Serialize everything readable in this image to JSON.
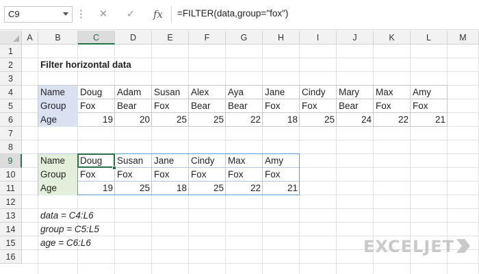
{
  "name_box": {
    "value": "C9"
  },
  "formula_bar": {
    "cancel_glyph": "✕",
    "enter_glyph": "✓",
    "fx_label": "fx",
    "formula": "=FILTER(data,group=\"fox\")"
  },
  "columns": [
    "A",
    "B",
    "C",
    "D",
    "E",
    "F",
    "G",
    "H",
    "I",
    "J",
    "K",
    "L",
    "M"
  ],
  "rows": [
    "1",
    "2",
    "3",
    "4",
    "5",
    "6",
    "7",
    "8",
    "9",
    "10",
    "11",
    "12",
    "13",
    "14",
    "15",
    "16"
  ],
  "selected": {
    "column": "C",
    "row": "9"
  },
  "title": "Filter horizontal data",
  "source_table": {
    "header_color": "#d9e1f2",
    "labels": [
      "Name",
      "Group",
      "Age"
    ],
    "names": [
      "Doug",
      "Adam",
      "Susan",
      "Alex",
      "Aya",
      "Jane",
      "Cindy",
      "Mary",
      "Max",
      "Amy"
    ],
    "groups": [
      "Fox",
      "Bear",
      "Fox",
      "Bear",
      "Bear",
      "Fox",
      "Fox",
      "Bear",
      "Fox",
      "Fox"
    ],
    "ages": [
      "19",
      "20",
      "25",
      "25",
      "22",
      "18",
      "25",
      "24",
      "22",
      "21"
    ]
  },
  "result_table": {
    "header_color": "#e2efda",
    "labels": [
      "Name",
      "Group",
      "Age"
    ],
    "names": [
      "Doug",
      "Susan",
      "Jane",
      "Cindy",
      "Max",
      "Amy"
    ],
    "groups": [
      "Fox",
      "Fox",
      "Fox",
      "Fox",
      "Fox",
      "Fox"
    ],
    "ages": [
      "19",
      "25",
      "18",
      "25",
      "22",
      "21"
    ]
  },
  "notes": [
    "data = C4:L6",
    "group = C5:L5",
    "age = C6:L6"
  ],
  "logo": {
    "text": "EXCELJET",
    "color": "#c9c9c9"
  },
  "colors": {
    "accent": "#217346",
    "spill_border": "#5b9bd5"
  }
}
